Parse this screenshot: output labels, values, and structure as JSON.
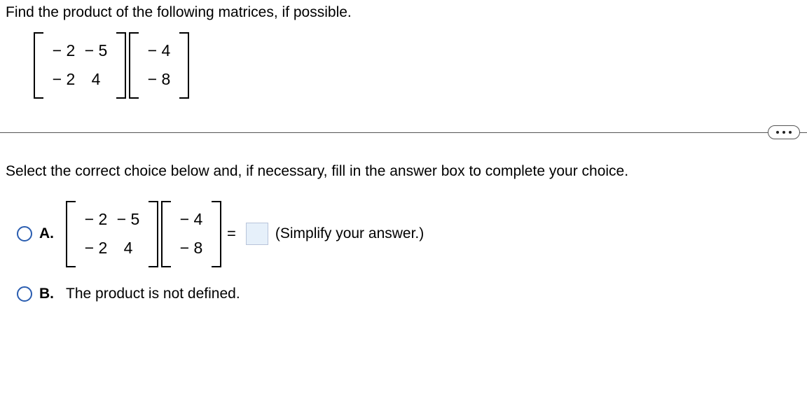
{
  "question": "Find the product of the following matrices, if possible.",
  "matrixA": {
    "r1c1": "− 2",
    "r1c2": "− 5",
    "r2c1": "− 2",
    "r2c2": "4"
  },
  "matrixB": {
    "r1c1": "− 4",
    "r2c1": "− 8"
  },
  "instruction": "Select the correct choice below and, if necessary, fill in the answer box to complete your choice.",
  "choices": {
    "A": {
      "label": "A.",
      "equals": "=",
      "hint": "(Simplify your answer.)"
    },
    "B": {
      "label": "B.",
      "text": "The product is not defined."
    }
  }
}
